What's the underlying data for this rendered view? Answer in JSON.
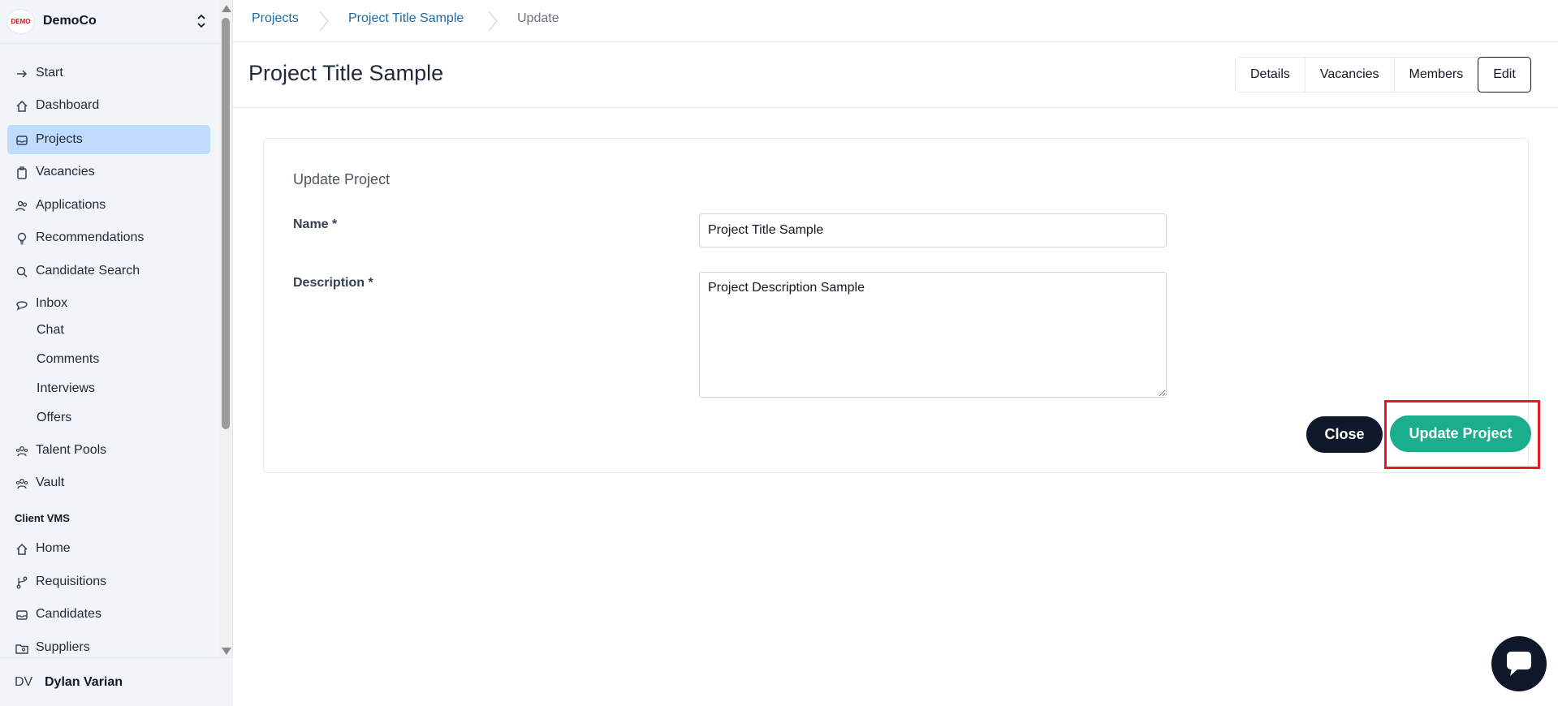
{
  "org": {
    "name": "DemoCo",
    "logo_text": "DEMO"
  },
  "sidebar": {
    "items": [
      {
        "label": "Start",
        "icon": "arrow-right-icon"
      },
      {
        "label": "Dashboard",
        "icon": "home-icon"
      },
      {
        "label": "Projects",
        "icon": "inbox-stack-icon",
        "active": true
      },
      {
        "label": "Vacancies",
        "icon": "clipboard-icon"
      },
      {
        "label": "Applications",
        "icon": "users-icon"
      },
      {
        "label": "Recommendations",
        "icon": "lightbulb-icon"
      },
      {
        "label": "Candidate Search",
        "icon": "search-icon"
      },
      {
        "label": "Inbox",
        "icon": "chat-bubble-icon"
      }
    ],
    "inbox_subitems": [
      "Chat",
      "Comments",
      "Interviews",
      "Offers"
    ],
    "more_items": [
      {
        "label": "Talent Pools",
        "icon": "people-group-icon"
      },
      {
        "label": "Vault",
        "icon": "people-group-icon"
      }
    ],
    "section_label": "Client VMS",
    "vms_items": [
      {
        "label": "Home",
        "icon": "home-icon"
      },
      {
        "label": "Requisitions",
        "icon": "branch-icon"
      },
      {
        "label": "Candidates",
        "icon": "inbox-stack-icon"
      },
      {
        "label": "Suppliers",
        "icon": "folder-user-icon"
      }
    ]
  },
  "user": {
    "initials": "DV",
    "name": "Dylan Varian"
  },
  "breadcrumbs": [
    "Projects",
    "Project Title Sample",
    "Update"
  ],
  "page": {
    "title": "Project Title Sample",
    "tabs": [
      "Details",
      "Vacancies",
      "Members",
      "Edit"
    ],
    "active_tab": "Edit"
  },
  "form": {
    "title": "Update Project",
    "name_label": "Name *",
    "name_value": "Project Title Sample",
    "description_label": "Description *",
    "description_value": "Project Description Sample",
    "close_label": "Close",
    "submit_label": "Update Project"
  },
  "colors": {
    "sidebar_bg": "#f1f5f9",
    "active_nav": "#bfdbfe",
    "link": "#1e6aa8",
    "primary_button": "#1aae8d",
    "dark_button": "#0f172a",
    "highlight": "#e11d2a"
  }
}
